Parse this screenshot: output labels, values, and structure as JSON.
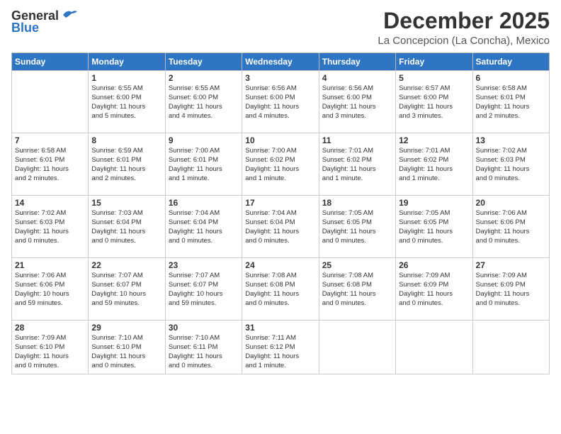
{
  "header": {
    "logo_line1": "General",
    "logo_line2": "Blue",
    "month": "December 2025",
    "location": "La Concepcion (La Concha), Mexico"
  },
  "days_of_week": [
    "Sunday",
    "Monday",
    "Tuesday",
    "Wednesday",
    "Thursday",
    "Friday",
    "Saturday"
  ],
  "weeks": [
    [
      {
        "day": "",
        "info": ""
      },
      {
        "day": "1",
        "info": "Sunrise: 6:55 AM\nSunset: 6:00 PM\nDaylight: 11 hours\nand 5 minutes."
      },
      {
        "day": "2",
        "info": "Sunrise: 6:55 AM\nSunset: 6:00 PM\nDaylight: 11 hours\nand 4 minutes."
      },
      {
        "day": "3",
        "info": "Sunrise: 6:56 AM\nSunset: 6:00 PM\nDaylight: 11 hours\nand 4 minutes."
      },
      {
        "day": "4",
        "info": "Sunrise: 6:56 AM\nSunset: 6:00 PM\nDaylight: 11 hours\nand 3 minutes."
      },
      {
        "day": "5",
        "info": "Sunrise: 6:57 AM\nSunset: 6:00 PM\nDaylight: 11 hours\nand 3 minutes."
      },
      {
        "day": "6",
        "info": "Sunrise: 6:58 AM\nSunset: 6:01 PM\nDaylight: 11 hours\nand 2 minutes."
      }
    ],
    [
      {
        "day": "7",
        "info": "Sunrise: 6:58 AM\nSunset: 6:01 PM\nDaylight: 11 hours\nand 2 minutes."
      },
      {
        "day": "8",
        "info": "Sunrise: 6:59 AM\nSunset: 6:01 PM\nDaylight: 11 hours\nand 2 minutes."
      },
      {
        "day": "9",
        "info": "Sunrise: 7:00 AM\nSunset: 6:01 PM\nDaylight: 11 hours\nand 1 minute."
      },
      {
        "day": "10",
        "info": "Sunrise: 7:00 AM\nSunset: 6:02 PM\nDaylight: 11 hours\nand 1 minute."
      },
      {
        "day": "11",
        "info": "Sunrise: 7:01 AM\nSunset: 6:02 PM\nDaylight: 11 hours\nand 1 minute."
      },
      {
        "day": "12",
        "info": "Sunrise: 7:01 AM\nSunset: 6:02 PM\nDaylight: 11 hours\nand 1 minute."
      },
      {
        "day": "13",
        "info": "Sunrise: 7:02 AM\nSunset: 6:03 PM\nDaylight: 11 hours\nand 0 minutes."
      }
    ],
    [
      {
        "day": "14",
        "info": "Sunrise: 7:02 AM\nSunset: 6:03 PM\nDaylight: 11 hours\nand 0 minutes."
      },
      {
        "day": "15",
        "info": "Sunrise: 7:03 AM\nSunset: 6:04 PM\nDaylight: 11 hours\nand 0 minutes."
      },
      {
        "day": "16",
        "info": "Sunrise: 7:04 AM\nSunset: 6:04 PM\nDaylight: 11 hours\nand 0 minutes."
      },
      {
        "day": "17",
        "info": "Sunrise: 7:04 AM\nSunset: 6:04 PM\nDaylight: 11 hours\nand 0 minutes."
      },
      {
        "day": "18",
        "info": "Sunrise: 7:05 AM\nSunset: 6:05 PM\nDaylight: 11 hours\nand 0 minutes."
      },
      {
        "day": "19",
        "info": "Sunrise: 7:05 AM\nSunset: 6:05 PM\nDaylight: 11 hours\nand 0 minutes."
      },
      {
        "day": "20",
        "info": "Sunrise: 7:06 AM\nSunset: 6:06 PM\nDaylight: 11 hours\nand 0 minutes."
      }
    ],
    [
      {
        "day": "21",
        "info": "Sunrise: 7:06 AM\nSunset: 6:06 PM\nDaylight: 10 hours\nand 59 minutes."
      },
      {
        "day": "22",
        "info": "Sunrise: 7:07 AM\nSunset: 6:07 PM\nDaylight: 10 hours\nand 59 minutes."
      },
      {
        "day": "23",
        "info": "Sunrise: 7:07 AM\nSunset: 6:07 PM\nDaylight: 10 hours\nand 59 minutes."
      },
      {
        "day": "24",
        "info": "Sunrise: 7:08 AM\nSunset: 6:08 PM\nDaylight: 11 hours\nand 0 minutes."
      },
      {
        "day": "25",
        "info": "Sunrise: 7:08 AM\nSunset: 6:08 PM\nDaylight: 11 hours\nand 0 minutes."
      },
      {
        "day": "26",
        "info": "Sunrise: 7:09 AM\nSunset: 6:09 PM\nDaylight: 11 hours\nand 0 minutes."
      },
      {
        "day": "27",
        "info": "Sunrise: 7:09 AM\nSunset: 6:09 PM\nDaylight: 11 hours\nand 0 minutes."
      }
    ],
    [
      {
        "day": "28",
        "info": "Sunrise: 7:09 AM\nSunset: 6:10 PM\nDaylight: 11 hours\nand 0 minutes."
      },
      {
        "day": "29",
        "info": "Sunrise: 7:10 AM\nSunset: 6:10 PM\nDaylight: 11 hours\nand 0 minutes."
      },
      {
        "day": "30",
        "info": "Sunrise: 7:10 AM\nSunset: 6:11 PM\nDaylight: 11 hours\nand 0 minutes."
      },
      {
        "day": "31",
        "info": "Sunrise: 7:11 AM\nSunset: 6:12 PM\nDaylight: 11 hours\nand 1 minute."
      },
      {
        "day": "",
        "info": ""
      },
      {
        "day": "",
        "info": ""
      },
      {
        "day": "",
        "info": ""
      }
    ]
  ]
}
